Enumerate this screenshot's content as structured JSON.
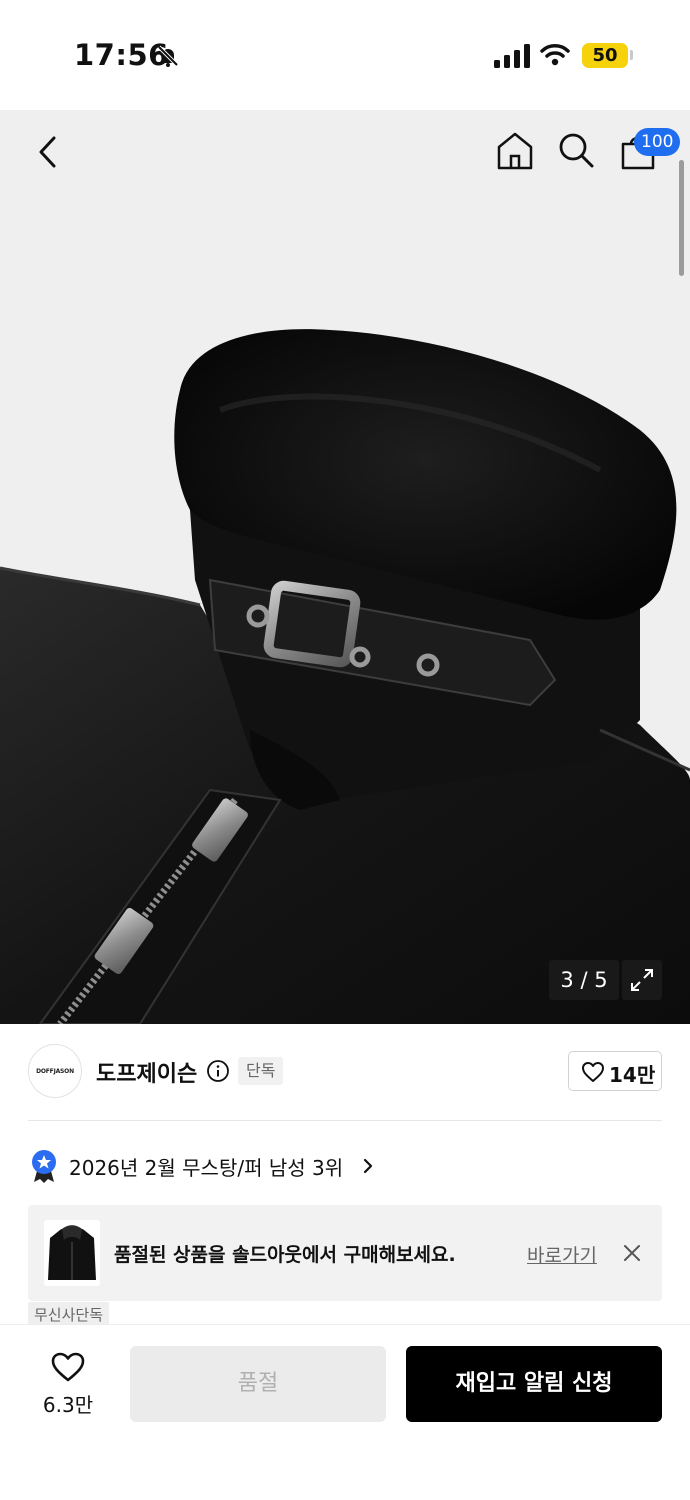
{
  "status_bar": {
    "time": "17:56",
    "battery": "50",
    "icons": [
      "bell-slash-icon",
      "cellular-signal-icon",
      "wifi-icon",
      "battery-icon"
    ]
  },
  "header": {
    "icons": [
      "back-icon",
      "home-icon",
      "search-icon",
      "shopping-bag-icon"
    ],
    "cart_count": "100"
  },
  "gallery": {
    "page_indicator": "3 / 5",
    "expand_icon": "expand-icon"
  },
  "brand": {
    "logo_text": "DOFFJASON",
    "name": "도프제이슨",
    "exclusive_label": "단독",
    "like_count": "14만"
  },
  "ranking": {
    "text": "2026년 2월 무스탕/퍼 남성 3위"
  },
  "banner": {
    "text": "품절된 상품을 솔드아웃에서 구매해보세요.",
    "link_label": "바로가기"
  },
  "tag": {
    "label": "무신사단독"
  },
  "bottom_bar": {
    "wish_count": "6.3만",
    "soldout_label": "품절",
    "restock_label": "재입고 알림 신청"
  },
  "colors": {
    "accent_blue": "#1f6ef0",
    "battery_yellow": "#f5d20c",
    "primary_button": "#000000",
    "disabled_button": "#ebebeb"
  }
}
